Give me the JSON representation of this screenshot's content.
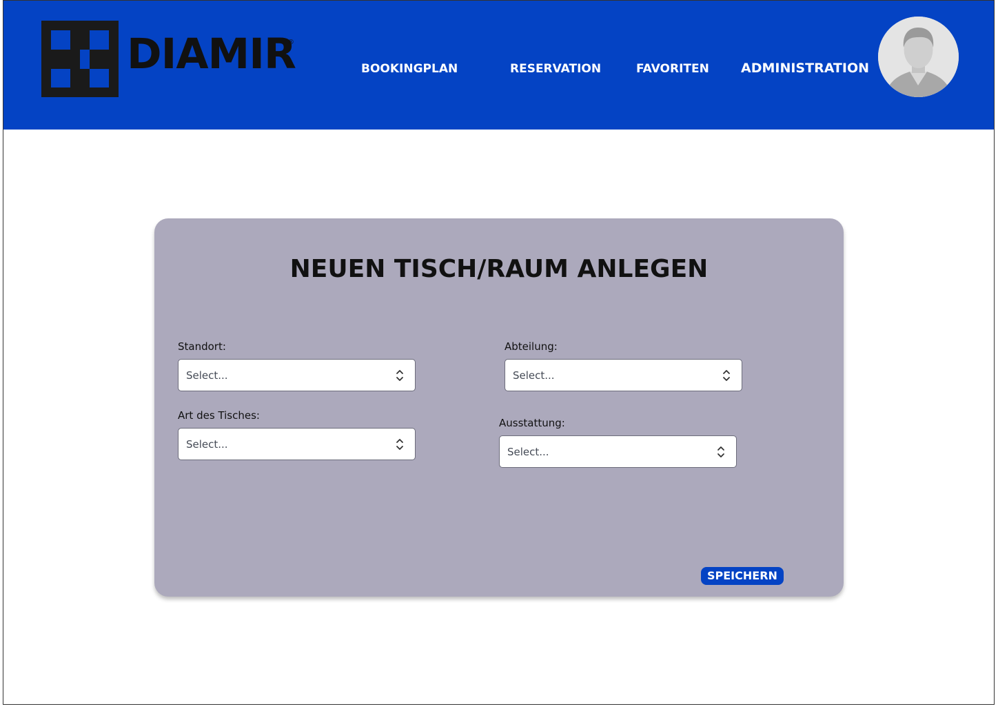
{
  "header": {
    "logo": {
      "text": "DIAMIR",
      "registered": "®"
    },
    "nav": [
      {
        "label": "BOOKINGPLAN"
      },
      {
        "label": "RESERVATION"
      },
      {
        "label": "FAVORITEN"
      },
      {
        "label": "ADMINISTRATION"
      }
    ],
    "avatar_icon": "user-avatar-photo"
  },
  "form": {
    "title": "NEUEN TISCH/RAUM ANLEGEN",
    "fields": {
      "standort": {
        "label": "Standort:",
        "placeholder": "Select..."
      },
      "abteilung": {
        "label": "Abteilung:",
        "placeholder": "Select..."
      },
      "art": {
        "label": "Art des Tisches:",
        "placeholder": "Select..."
      },
      "ausstattung": {
        "label": "Ausstattung:",
        "placeholder": "Select..."
      }
    },
    "save_label": "SPEICHERN"
  },
  "colors": {
    "brand_blue": "#0443c4",
    "card_background": "#aca9bc",
    "logo_black": "#111111"
  }
}
